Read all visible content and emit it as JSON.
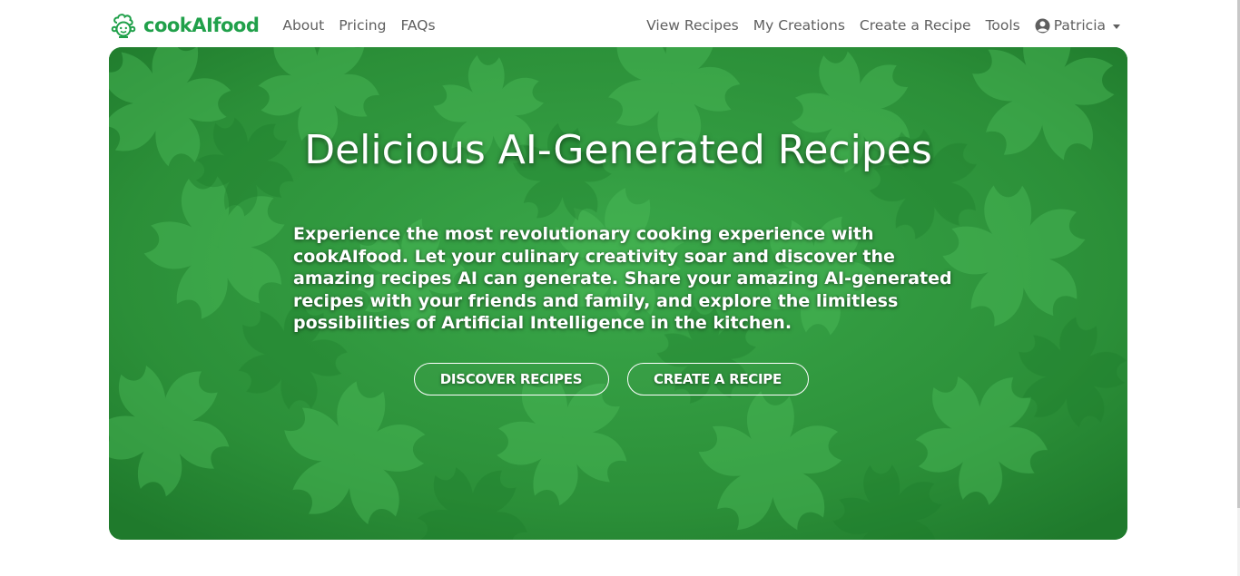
{
  "navbar": {
    "brand": "cookAIfood",
    "brand_icon": "chef-hat-icon",
    "left_links": [
      "About",
      "Pricing",
      "FAQs"
    ],
    "right_links": [
      "View Recipes",
      "My Creations",
      "Create a Recipe",
      "Tools"
    ],
    "user": {
      "name": "Patricia",
      "icon": "user-circle-icon"
    }
  },
  "hero": {
    "title": "Delicious AI-Generated Recipes",
    "description": "Experience the most revolutionary cooking experience with cookAIfood. Let your culinary creativity soar and discover the amazing recipes AI can generate. Share your amazing AI-generated recipes with your friends and family, and explore the limitless possibilities of Artificial Intelligence in the kitchen.",
    "buttons": {
      "discover": "DISCOVER RECIPES",
      "create": "CREATE A RECIPE"
    },
    "background": "parsley-leaves-background"
  },
  "colors": {
    "brand_green": "#20a04a",
    "nav_text": "#5f5f5f",
    "hero_green": "#2f9c3e"
  }
}
